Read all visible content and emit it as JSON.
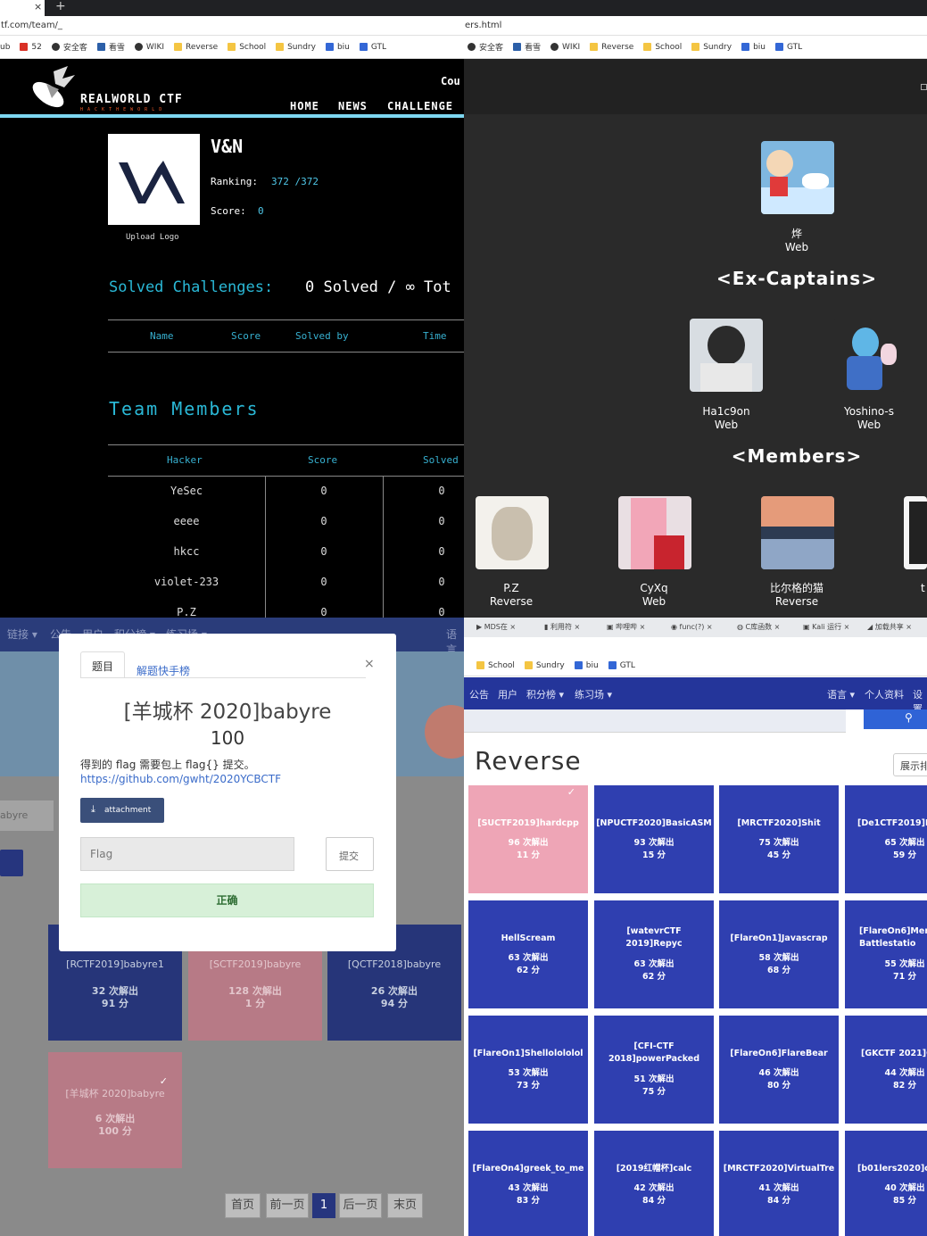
{
  "tl": {
    "tab_close": "×",
    "tab_new": "+",
    "url": "tf.com/team/_",
    "bookmarks": [
      "ub",
      "52",
      "安全客",
      "看雪",
      "WIKI",
      "Reverse",
      "School",
      "Sundry",
      "biu",
      "GTL"
    ],
    "brand": "REALWORLD CTF",
    "brand_sub": "H A C K T H E W O R L D",
    "nav": [
      "HOME",
      "NEWS",
      "CHALLENGE"
    ],
    "nav_extra": "Cou",
    "team_name": "V&N",
    "upload_logo": "Upload Logo",
    "ranking_label": "Ranking:",
    "ranking_value": "372 /372",
    "score_label": "Score:",
    "score_value": "0",
    "solved_title_a": "Solved Challenges:",
    "solved_title_b": "0 Solved / ∞ Tot",
    "solved_cols": [
      "Name",
      "Score",
      "Solved by",
      "Time"
    ],
    "members_title": "Team Members",
    "member_cols": [
      "Hacker",
      "Score",
      "Solved"
    ],
    "members": [
      {
        "name": "YeSec",
        "score": "0",
        "solved": "0"
      },
      {
        "name": "eeee",
        "score": "0",
        "solved": "0"
      },
      {
        "name": "hkcc",
        "score": "0",
        "solved": "0"
      },
      {
        "name": "violet-233",
        "score": "0",
        "solved": "0"
      },
      {
        "name": "P.Z",
        "score": "0",
        "solved": "0"
      }
    ]
  },
  "tr": {
    "url": "ers.html",
    "bookmarks": [
      "安全客",
      "看雪",
      "WIKI",
      "Reverse",
      "School",
      "Sundry",
      "biu",
      "GTL"
    ],
    "captain": {
      "name": "烨",
      "role": "Web"
    },
    "ex_captains_title": "<Ex-Captains>",
    "ex_captains": [
      {
        "name": "Ha1c9on",
        "role": "Web"
      },
      {
        "name": "Yoshino-s",
        "role": "Web"
      }
    ],
    "members_title": "<Members>",
    "members": [
      {
        "name": "P.Z",
        "role": "Reverse"
      },
      {
        "name": "CyXq",
        "role": "Web"
      },
      {
        "name": "比尔格的猫",
        "role": "Reverse"
      },
      {
        "name": "t",
        "role": ""
      }
    ]
  },
  "bl": {
    "nav": [
      "链接 ▾",
      "公告",
      "用户",
      "积分榜 ▾",
      "练习场 ▾"
    ],
    "nav_right": "语言",
    "side_text": "abyre",
    "modal": {
      "tabs": [
        "题目",
        "解题快手榜"
      ],
      "close": "×",
      "title": "[羊城杯 2020]babyre",
      "points": "100",
      "desc": "得到的 flag 需要包上 flag{} 提交。",
      "link": "https://github.com/gwht/2020YCBCTF",
      "attachment": "attachment",
      "flag_placeholder": "Flag",
      "submit": "提交",
      "result": "正确"
    },
    "cards": [
      {
        "name": "[RCTF2019]babyre1",
        "solves": "32 次解出",
        "score": "91 分",
        "solved": false
      },
      {
        "name": "[SCTF2019]babyre",
        "solves": "128 次解出",
        "score": "1 分",
        "solved": true
      },
      {
        "name": "[QCTF2018]babyre",
        "solves": "26 次解出",
        "score": "94 分",
        "solved": false
      },
      {
        "name": "[羊城杯 2020]babyre",
        "solves": "6 次解出",
        "score": "100 分",
        "solved": true
      }
    ],
    "pagination": [
      "首页",
      "前一页",
      "1",
      "后一页",
      "末页"
    ]
  },
  "br": {
    "tabs": [
      "MDS在",
      "利用符",
      "哔哩哔",
      "func(?)",
      "C库函数",
      "Kali 运行",
      "加载共享"
    ],
    "bookmarks": [
      "School",
      "Sundry",
      "biu",
      "GTL"
    ],
    "nav": [
      "公告",
      "用户",
      "积分榜 ▾",
      "练习场 ▾"
    ],
    "nav_right": [
      "语言 ▾",
      "个人资料",
      "设置"
    ],
    "category": "Reverse",
    "display_button": "展示排",
    "challenges": [
      {
        "name": "[SUCTF2019]hardcpp",
        "solves": "96 次解出",
        "score": "11 分",
        "solved": true
      },
      {
        "name": "[NPUCTF2020]BasicASM",
        "solves": "93 次解出",
        "score": "15 分",
        "solved": false
      },
      {
        "name": "[MRCTF2020]Shit",
        "solves": "75 次解出",
        "score": "45 分",
        "solved": false
      },
      {
        "name": "[De1CTF2019]R",
        "solves": "65 次解出",
        "score": "59 分",
        "solved": false
      },
      {
        "name": "HellScream",
        "solves": "63 次解出",
        "score": "62 分",
        "solved": false
      },
      {
        "name": "[watevrCTF 2019]Repyc",
        "solves": "63 次解出",
        "score": "62 分",
        "solved": false
      },
      {
        "name": "[FlareOn1]Javascrap",
        "solves": "58 次解出",
        "score": "68 分",
        "solved": false
      },
      {
        "name": "[FlareOn6]Mem Battlestatio",
        "solves": "55 次解出",
        "score": "71 分",
        "solved": false
      },
      {
        "name": "[FlareOn1]Shellolololol",
        "solves": "53 次解出",
        "score": "73 分",
        "solved": false
      },
      {
        "name": "[CFI-CTF 2018]powerPacked",
        "solves": "51 次解出",
        "score": "75 分",
        "solved": false
      },
      {
        "name": "[FlareOn6]FlareBear",
        "solves": "46 次解出",
        "score": "80 分",
        "solved": false
      },
      {
        "name": "[GKCTF 2021]C",
        "solves": "44 次解出",
        "score": "82 分",
        "solved": false
      },
      {
        "name": "[FlareOn4]greek_to_me",
        "solves": "43 次解出",
        "score": "83 分",
        "solved": false
      },
      {
        "name": "[2019红帽杯]calc",
        "solves": "42 次解出",
        "score": "84 分",
        "solved": false
      },
      {
        "name": "[MRCTF2020]VirtualTre",
        "solves": "41 次解出",
        "score": "84 分",
        "solved": false
      },
      {
        "name": "[b01lers2020]cl",
        "solves": "40 次解出",
        "score": "85 分",
        "solved": false
      }
    ]
  }
}
